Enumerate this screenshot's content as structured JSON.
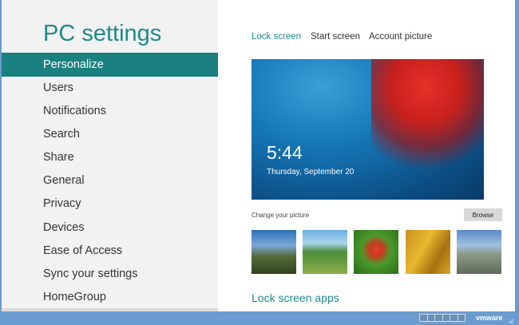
{
  "sidebar": {
    "title": "PC settings",
    "items": [
      {
        "label": "Personalize",
        "selected": true
      },
      {
        "label": "Users"
      },
      {
        "label": "Notifications"
      },
      {
        "label": "Search"
      },
      {
        "label": "Share"
      },
      {
        "label": "General"
      },
      {
        "label": "Privacy"
      },
      {
        "label": "Devices"
      },
      {
        "label": "Ease of Access"
      },
      {
        "label": "Sync your settings"
      },
      {
        "label": "HomeGroup"
      }
    ]
  },
  "tabs": [
    {
      "label": "Lock screen",
      "active": true
    },
    {
      "label": "Start screen"
    },
    {
      "label": "Account picture"
    }
  ],
  "lock_preview": {
    "time": "5:44",
    "date": "Thursday, September 20"
  },
  "change_picture_label": "Change your picture",
  "browse_label": "Browse",
  "lock_screen_apps_label": "Lock screen apps",
  "taskbar": {
    "brand": "vmware"
  },
  "colors": {
    "accent": "#1a8080",
    "frame": "#6a9ccf"
  }
}
